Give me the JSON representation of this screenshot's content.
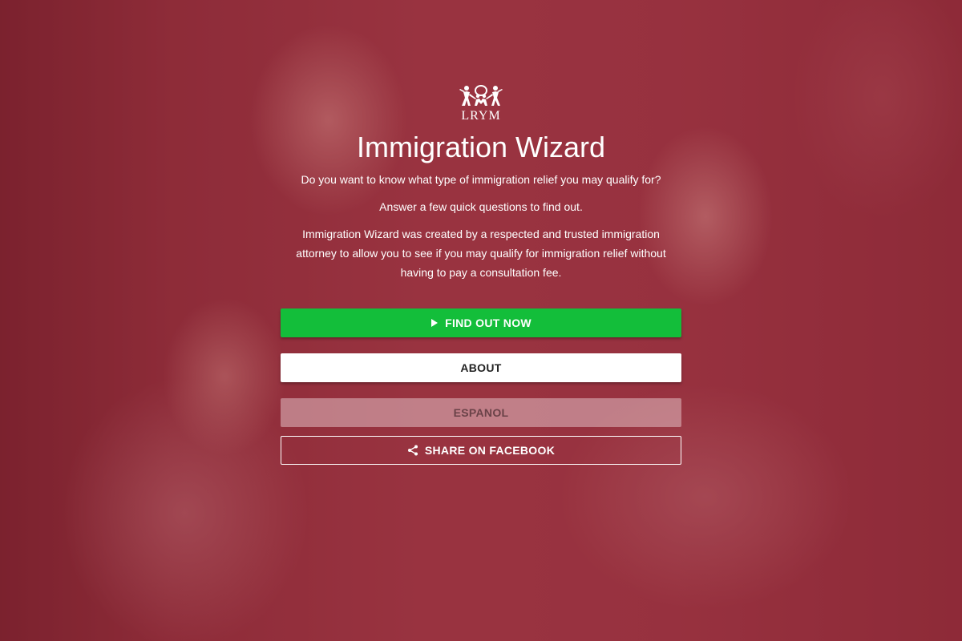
{
  "logo": {
    "text": "LRYM",
    "icon": "family-figures-icon"
  },
  "header": {
    "title": "Immigration Wizard"
  },
  "intro": {
    "question": "Do you want to know what type of immigration relief you may qualify for?",
    "cta_text": "Answer a few quick questions to find out.",
    "description": "Immigration Wizard was created by a respected and trusted immigration attorney to allow you to see if you may qualify for immigration relief without having to pay a consultation fee."
  },
  "buttons": {
    "find_out": {
      "label": "FIND OUT NOW",
      "icon": "play-icon"
    },
    "about": {
      "label": "ABOUT"
    },
    "espanol": {
      "label": "ESPANOL"
    },
    "share": {
      "label": "SHARE ON FACEBOOK",
      "icon": "share-icon"
    }
  },
  "colors": {
    "primary_green": "#13be3a",
    "overlay_red": "#963744",
    "white": "#ffffff"
  }
}
